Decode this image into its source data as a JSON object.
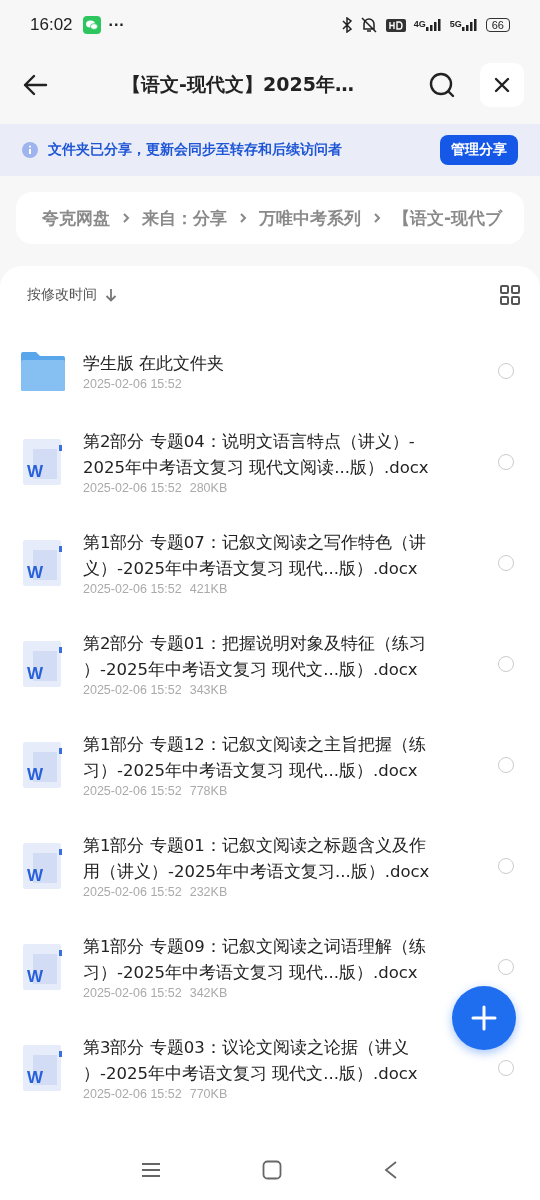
{
  "status_bar": {
    "time": "16:02",
    "more": "···",
    "battery": "66",
    "network_1": "4G",
    "network_2": "5G"
  },
  "header": {
    "title": "【语文-现代文】2025年…"
  },
  "share_banner": {
    "message": "文件夹已分享，更新会同步至转存和后续访问者",
    "button": "管理分享"
  },
  "breadcrumb": [
    "夸克网盘",
    "来自：分享",
    "万唯中考系列",
    "【语文-现代ブ"
  ],
  "sort": {
    "label": "按修改时间"
  },
  "files": [
    {
      "kind": "folder",
      "lines": [
        "学生版 在此文件夹"
      ],
      "date": "2025-02-06 15:52",
      "selected": false
    },
    {
      "kind": "word",
      "icon_letter": "W",
      "lines": [
        "第2部分 专题04：说明文语言特点（讲义）-",
        "2025年中考语文复习 现代文阅读...版）.docx"
      ],
      "date": "2025-02-06 15:52",
      "size": "280KB",
      "selected": false
    },
    {
      "kind": "word",
      "icon_letter": "W",
      "lines": [
        "第1部分 专题07：记叙文阅读之写作特色（讲",
        "义）-2025年中考语文复习 现代...版）.docx"
      ],
      "date": "2025-02-06 15:52",
      "size": "421KB",
      "selected": false
    },
    {
      "kind": "word",
      "icon_letter": "W",
      "lines": [
        "第2部分 专题01：把握说明对象及特征（练习",
        "）-2025年中考语文复习 现代文...版）.docx"
      ],
      "date": "2025-02-06 15:52",
      "size": "343KB",
      "selected": false
    },
    {
      "kind": "word",
      "icon_letter": "W",
      "lines": [
        "第1部分 专题12：记叙文阅读之主旨把握（练",
        "习）-2025年中考语文复习 现代...版）.docx"
      ],
      "date": "2025-02-06 15:52",
      "size": "778KB",
      "selected": false
    },
    {
      "kind": "word",
      "icon_letter": "W",
      "lines": [
        "第1部分 专题01：记叙文阅读之标题含义及作",
        "用（讲义）-2025年中考语文复习...版）.docx"
      ],
      "date": "2025-02-06 15:52",
      "size": "232KB",
      "selected": false
    },
    {
      "kind": "word",
      "icon_letter": "W",
      "lines": [
        "第1部分 专题09：记叙文阅读之词语理解（练",
        "习）-2025年中考语文复习 现代...版）.docx"
      ],
      "date": "2025-02-06 15:52",
      "size": "342KB",
      "selected": false
    },
    {
      "kind": "word",
      "icon_letter": "W",
      "lines": [
        "第3部分 专题03：议论文阅读之论据（讲义",
        "）-2025年中考语文复习 现代文...版）.docx"
      ],
      "date": "2025-02-06 15:52",
      "size": "770KB",
      "selected": false
    }
  ]
}
